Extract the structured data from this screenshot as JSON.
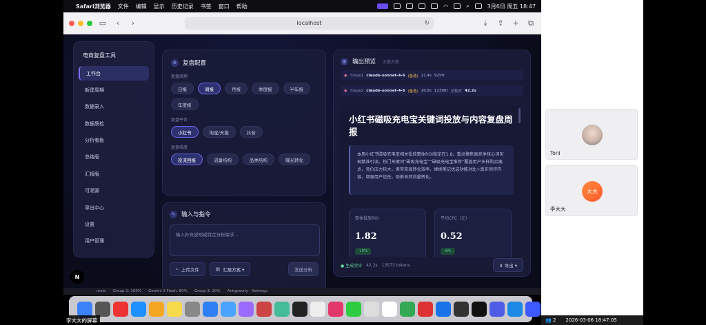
{
  "menubar": {
    "app": "Safari浏览器",
    "items": [
      "文件",
      "编辑",
      "显示",
      "历史记录",
      "书签",
      "窗口",
      "帮助"
    ],
    "clock": "3月6日 周五 18:47"
  },
  "browser": {
    "url": "localhost"
  },
  "sidebar": {
    "title": "电商复盘工具",
    "items": [
      "工作台",
      "新建周期",
      "数据录入",
      "数据质检",
      "分析看板",
      "总结版",
      "汇报版",
      "可溯源",
      "导出中心",
      "设置",
      "用户管理"
    ]
  },
  "config": {
    "title": "复盘配置",
    "period_label": "复盘周期",
    "periods": [
      "日报",
      "周报",
      "月报",
      "季度报",
      "半年报",
      "年度报"
    ],
    "platform_label": "复盘平台",
    "platforms": [
      "小红书",
      "淘宝/天猫",
      "抖音"
    ],
    "dimension_label": "复盘维度",
    "dimensions": [
      "投流回报",
      "流量结构",
      "品类结构",
      "曝光转化"
    ]
  },
  "command": {
    "title": "输入与指令",
    "placeholder": "输入补充说明或特定分析需求...",
    "upload_label": "上传文件",
    "scheme_label": "汇报方案 ▾",
    "send_label": "发送分析"
  },
  "output": {
    "title": "输出预览",
    "subtitle": "汇报方案",
    "stage1": {
      "name": "Stage1",
      "model": "claude-sonnet-4-6",
      "tag": "(备选)",
      "time": "21.4s",
      "tokens": "925tt"
    },
    "stage2": {
      "name": "Stage2",
      "model": "claude-sonnet-4-6",
      "tag": "(备选)",
      "time": "20.8s",
      "tokens": "12390t",
      "total_label": "总耗时",
      "total": "42.2s"
    },
    "report_title": "小红书磁吸充电宝关键词投放与内容复盘周报",
    "summary": "本周小红书磁吸充电宝相关投放整体ROI稳定在1.8。重点聚焦高竞争核心词实现精准引流。热门关键词“磁吸充电宝”“磁吸充电宝推荐”覆盖用户多样购买痛点，竞价压力较大，但带来高转化效率。继续笔记优选功能对比+真实测评内容，增强用户信任，助推自然流量转化。",
    "metrics": [
      {
        "label": "整体投放ROI",
        "value": "1.82",
        "delta": "+5%"
      },
      {
        "label": "平均CPC（元）",
        "value": "0.52",
        "delta": "-8%"
      }
    ],
    "footer_status": "● 生成完毕",
    "footer_time": "42.2s",
    "footer_tokens": "13573 tokens",
    "export_label": "⬇ 导出 ▾"
  },
  "status_strip": [
    "main",
    "Group 1: 100%",
    "Gemini 3 Flash: 80%",
    "Group 3: 20%",
    "Antigravity - Settings"
  ],
  "share_label": "李大大的屏幕",
  "participants": [
    {
      "name": "Toni"
    },
    {
      "name": "李大大",
      "avatar_text": "大大"
    }
  ],
  "meeting_bar": {
    "count": "2",
    "time": "2026-03-06 18:47:05"
  },
  "badge": "N"
}
